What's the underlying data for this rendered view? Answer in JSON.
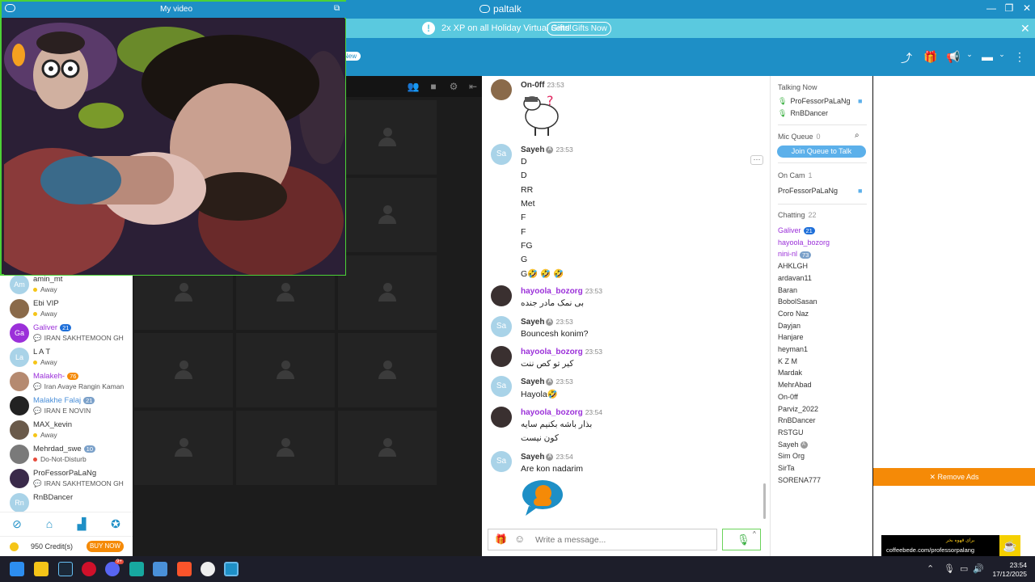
{
  "app": {
    "title": "paltalk",
    "video_window_title": "My video",
    "new_badge": "New"
  },
  "promo": {
    "text": "2x XP on all Holiday Virtual Gifts!",
    "button": "Send Gifts Now"
  },
  "users_left": [
    {
      "name": "amin_mt",
      "initials": "Am",
      "status": "Away",
      "status_color": "#f5c518",
      "name_color": "#333333",
      "avatar_color": "#a9d3e8"
    },
    {
      "name": "Ebi VIP",
      "initials": "",
      "status": "Away",
      "status_color": "#f5c518",
      "name_color": "#333333",
      "avatar_color": "#8a6a4a"
    },
    {
      "name": "Galiver",
      "initials": "Ga",
      "level": "21",
      "level_color": "#1e6fd9",
      "status": "IRAN SAKHTEMOON GHESMAT",
      "status_type": "room",
      "name_color": "#9b30d9",
      "avatar_color": "#9b30d9"
    },
    {
      "name": "L A T",
      "initials": "La",
      "status": "Away",
      "status_color": "#f5c518",
      "name_color": "#333333",
      "avatar_color": "#a9d3e8"
    },
    {
      "name": "Malakeh-",
      "initials": "",
      "level": "76",
      "level_color": "#f58a07",
      "status": "Iran Avaye Rangin Kaman",
      "status_type": "room",
      "name_color": "#9b30d9",
      "avatar_color": "#b58a70"
    },
    {
      "name": "Malakhe Falaj",
      "initials": "",
      "level": "21",
      "level_color": "#7aa0c9",
      "status": "IRAN E NOVIN",
      "status_type": "room",
      "name_color": "#4a8fd9",
      "avatar_color": "#222222"
    },
    {
      "name": "MAX_kevin",
      "initials": "",
      "status": "Away",
      "status_color": "#f5c518",
      "name_color": "#333333",
      "avatar_color": "#6a5a4a"
    },
    {
      "name": "Mehrdad_swe",
      "initials": "",
      "level": "10",
      "level_color": "#7aa0c9",
      "status": "Do-Not-Disturb",
      "status_color": "#e74c3c",
      "name_color": "#333333",
      "avatar_color": "#7a7a7a"
    },
    {
      "name": "ProFessorPaLaNg",
      "initials": "",
      "status": "IRAN SAKHTEMOON GHESMAT",
      "status_type": "room",
      "name_color": "#333333",
      "avatar_color": "#3a2a4a"
    },
    {
      "name": "RnBDancer",
      "initials": "Rn",
      "status": "",
      "name_color": "#333333",
      "avatar_color": "#a9d3e8"
    }
  ],
  "credits": {
    "text": "950 Credit(s)",
    "buy": "BUY NOW"
  },
  "chat": {
    "input_placeholder": "Write a message...",
    "messages": [
      {
        "user": "On-0ff",
        "time": "23:53",
        "lines": [],
        "name_color": "#333333",
        "avatar_color": "#8a6a4a",
        "initials": ""
      },
      {
        "user": "Sayeh",
        "time": "23:53",
        "crown": true,
        "lines": [
          "D",
          "D",
          "RR",
          "Met",
          "F",
          "F",
          "FG",
          "G",
          "G🤣 🤣 🤣"
        ],
        "name_color": "#333333",
        "avatar_color": "#a9d3e8",
        "initials": "Sa"
      },
      {
        "user": "hayoola_bozorg",
        "time": "23:53",
        "lines": [
          "بی نمک مادر جنده"
        ],
        "name_color": "#9b30d9",
        "avatar_color": "#3a3030",
        "initials": ""
      },
      {
        "user": "Sayeh",
        "time": "23:53",
        "crown": true,
        "lines": [
          "Bouncesh konim?"
        ],
        "name_color": "#333333",
        "avatar_color": "#a9d3e8",
        "initials": "Sa"
      },
      {
        "user": "hayoola_bozorg",
        "time": "23:53",
        "lines": [
          "کیر تو کص ننت"
        ],
        "name_color": "#9b30d9",
        "avatar_color": "#3a3030",
        "initials": ""
      },
      {
        "user": "Sayeh",
        "time": "23:53",
        "crown": true,
        "lines": [
          "Hayola🤣"
        ],
        "name_color": "#333333",
        "avatar_color": "#a9d3e8",
        "initials": "Sa"
      },
      {
        "user": "hayoola_bozorg",
        "time": "23:54",
        "lines": [
          "بذار باشه بکنیم سایه",
          "کون نیست"
        ],
        "name_color": "#9b30d9",
        "avatar_color": "#3a3030",
        "initials": ""
      },
      {
        "user": "Sayeh",
        "time": "23:54",
        "crown": true,
        "lines": [
          "Are kon nadarim"
        ],
        "name_color": "#333333",
        "avatar_color": "#a9d3e8",
        "initials": "Sa"
      }
    ]
  },
  "right": {
    "talking_now": {
      "label": "Talking Now",
      "users": [
        "ProFessorPaLaNg",
        "RnBDancer"
      ]
    },
    "mic_queue": {
      "label": "Mic Queue",
      "count": "0",
      "button": "Join Queue to Talk"
    },
    "on_cam": {
      "label": "On Cam",
      "count": "1",
      "users": [
        "ProFessorPaLaNg"
      ]
    },
    "chatting": {
      "label": "Chatting",
      "count": "22",
      "users": [
        {
          "name": "Galiver",
          "color": "#9b30d9",
          "level": "21",
          "level_color": "#1e6fd9"
        },
        {
          "name": "hayoola_bozorg",
          "color": "#9b30d9"
        },
        {
          "name": "nini-nl",
          "color": "#9b30d9",
          "level": "73",
          "level_color": "#7aa0c9"
        },
        {
          "name": "AHKLGH"
        },
        {
          "name": "ardavan11"
        },
        {
          "name": "Baran"
        },
        {
          "name": "BobolSasan"
        },
        {
          "name": "Coro Naz"
        },
        {
          "name": "Dayjan"
        },
        {
          "name": "Hanjare"
        },
        {
          "name": "heyman1"
        },
        {
          "name": "K Z M"
        },
        {
          "name": "Mardak"
        },
        {
          "name": "MehrAbad"
        },
        {
          "name": "On-0ff"
        },
        {
          "name": "Parviz_2022"
        },
        {
          "name": "RnBDancer"
        },
        {
          "name": "RSTGU"
        },
        {
          "name": "Sayeh",
          "crown": true
        },
        {
          "name": "Sim Org"
        },
        {
          "name": "SirTa"
        },
        {
          "name": "SORENA777"
        }
      ]
    }
  },
  "ads": {
    "remove": "✕ Remove Ads",
    "ad_line1": "برای قهوه بخر",
    "ad_line2": "coffeebede.com/professorpalang"
  },
  "taskbar": {
    "time": "23:54",
    "date": "17/12/2025",
    "discord_badge": "9+"
  }
}
